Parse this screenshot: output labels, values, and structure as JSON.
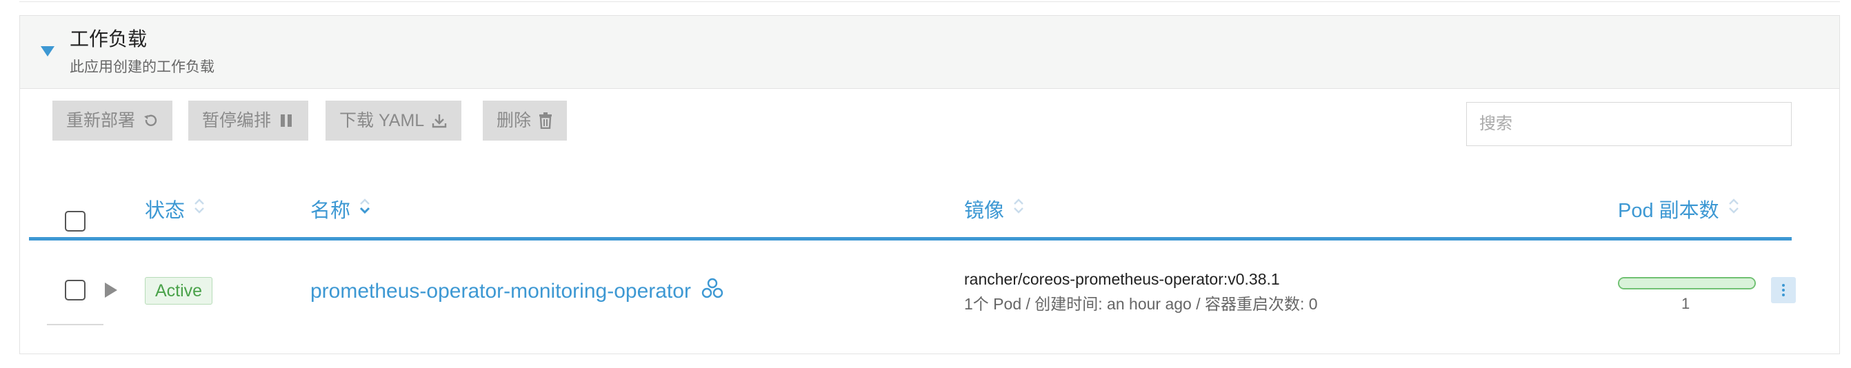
{
  "section": {
    "title": "工作负载",
    "subtitle": "此应用创建的工作负载"
  },
  "toolbar": {
    "redeploy_label": "重新部署",
    "pause_label": "暂停编排",
    "download_label": "下载 YAML",
    "delete_label": "删除"
  },
  "search": {
    "placeholder": "搜索",
    "value": ""
  },
  "table": {
    "columns": {
      "state": "状态",
      "name": "名称",
      "image": "镜像",
      "pods": "Pod 副本数"
    },
    "rows": [
      {
        "state": "Active",
        "name": "prometheus-operator-monitoring-operator",
        "image": "rancher/coreos-prometheus-operator:v0.38.1",
        "details": "1个 Pod / 创建时间: an hour ago / 容器重启次数: 0",
        "pod_count": "1",
        "pod_ready_fraction": 1.0
      }
    ]
  },
  "colors": {
    "accent": "#3d98d3",
    "active_badge_text": "#4aa24a",
    "active_badge_bg": "#eaf6ea",
    "progress_border": "#70c172",
    "button_bg": "#dcdcdc"
  },
  "icons": {
    "section_toggle": "caret-down-icon",
    "redeploy": "redo-icon",
    "pause": "pause-icon",
    "download": "download-icon",
    "delete": "trash-icon",
    "sort": "sort-icon",
    "expand_row": "caret-right-icon",
    "workload": "cluster-nodes-icon",
    "actions": "kebab-menu-icon"
  }
}
